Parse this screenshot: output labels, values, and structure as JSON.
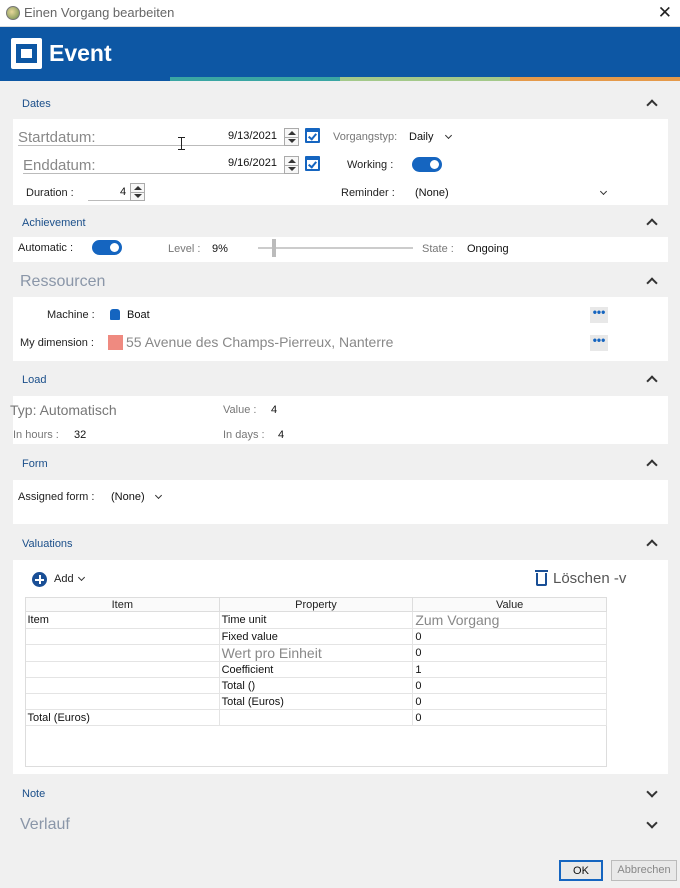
{
  "window": {
    "title": "Einen Vorgang bearbeiten",
    "close": "✕"
  },
  "header": {
    "title": "Event"
  },
  "colors": {
    "brand": "#0d57a4",
    "accent": "#1565c0",
    "stripe_teal": "#3aa6a3",
    "stripe_green": "#a4c98a",
    "stripe_orange": "#e59a4a",
    "swatch": "#ef8a80"
  },
  "dates": {
    "title": "Dates",
    "start_label": "Startdatum:",
    "start_value": "9/13/2021",
    "end_label": "Enddatum:",
    "end_value": "9/16/2021",
    "duration_label": "Duration :",
    "duration_value": "4",
    "type_label": "Vorgangstyp:",
    "type_value": "Daily",
    "working_label": "Working :",
    "working_on": true,
    "reminder_label": "Reminder :",
    "reminder_value": "(None)"
  },
  "achievement": {
    "title": "Achievement",
    "automatic_label": "Automatic :",
    "automatic_on": true,
    "level_label": "Level :",
    "level_value": "9%",
    "level_fraction": 0.09,
    "state_label": "State :",
    "state_value": "Ongoing"
  },
  "resources": {
    "title": "Ressourcen",
    "machine_label": "Machine :",
    "machine_value": "Boat",
    "machine_icon": "boat-icon",
    "dimension_label": "My dimension :",
    "dimension_value": "55 Avenue des Champs-Pierreux, Nanterre",
    "more": "•••"
  },
  "load": {
    "title": "Load",
    "type_text": "Typ: Automatisch",
    "value_label": "Value :",
    "value_value": "4",
    "hours_label": "In hours :",
    "hours_value": "32",
    "days_label": "In days :",
    "days_value": "4"
  },
  "form": {
    "title": "Form",
    "assigned_label": "Assigned form :",
    "assigned_value": "(None)"
  },
  "valuations": {
    "title": "Valuations",
    "add_label": "Add",
    "delete_label": "Löschen -v",
    "columns": [
      "Item",
      "Property",
      "Value"
    ],
    "rows": [
      {
        "item": "Item",
        "property": "Time unit",
        "value": "Zum Vorgang"
      },
      {
        "item": "",
        "property": "Fixed value",
        "value": "0"
      },
      {
        "item": "",
        "property": "Wert pro Einheit",
        "value": "0"
      },
      {
        "item": "",
        "property": "Coefficient",
        "value": "1"
      },
      {
        "item": "",
        "property": "Total ()",
        "value": "0"
      },
      {
        "item": "",
        "property": "Total (Euros)",
        "value": "0"
      },
      {
        "item": "Total (Euros)",
        "property": "",
        "value": "0"
      }
    ]
  },
  "note": {
    "title": "Note"
  },
  "history": {
    "title": "Verlauf"
  },
  "footer": {
    "ok": "OK",
    "cancel": "Abbrechen"
  }
}
